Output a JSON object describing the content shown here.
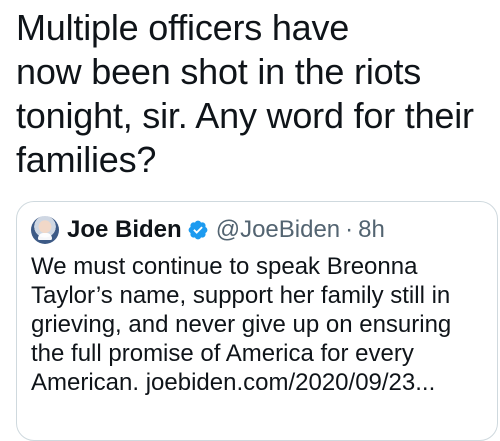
{
  "main_tweet": {
    "lines": [
      "Multiple officers have",
      "now been shot in the riots",
      "tonight, sir. Any word for their",
      "families?"
    ]
  },
  "quoted_tweet": {
    "display_name": "Joe Biden",
    "handle": "@JoeBiden",
    "separator": "·",
    "time": "8h",
    "verified_icon": "verified-badge",
    "avatar_icon": "profile-avatar",
    "lines": [
      "We must continue to speak Breonna",
      "Taylor’s name, support her family still in",
      "grieving, and never give up on ensuring",
      "the full promise of America for every",
      "American. joebiden.com/2020/09/23..."
    ],
    "colors": {
      "verified": "#1d9bf0",
      "muted_text": "#536471",
      "border": "#cfd9de"
    }
  }
}
